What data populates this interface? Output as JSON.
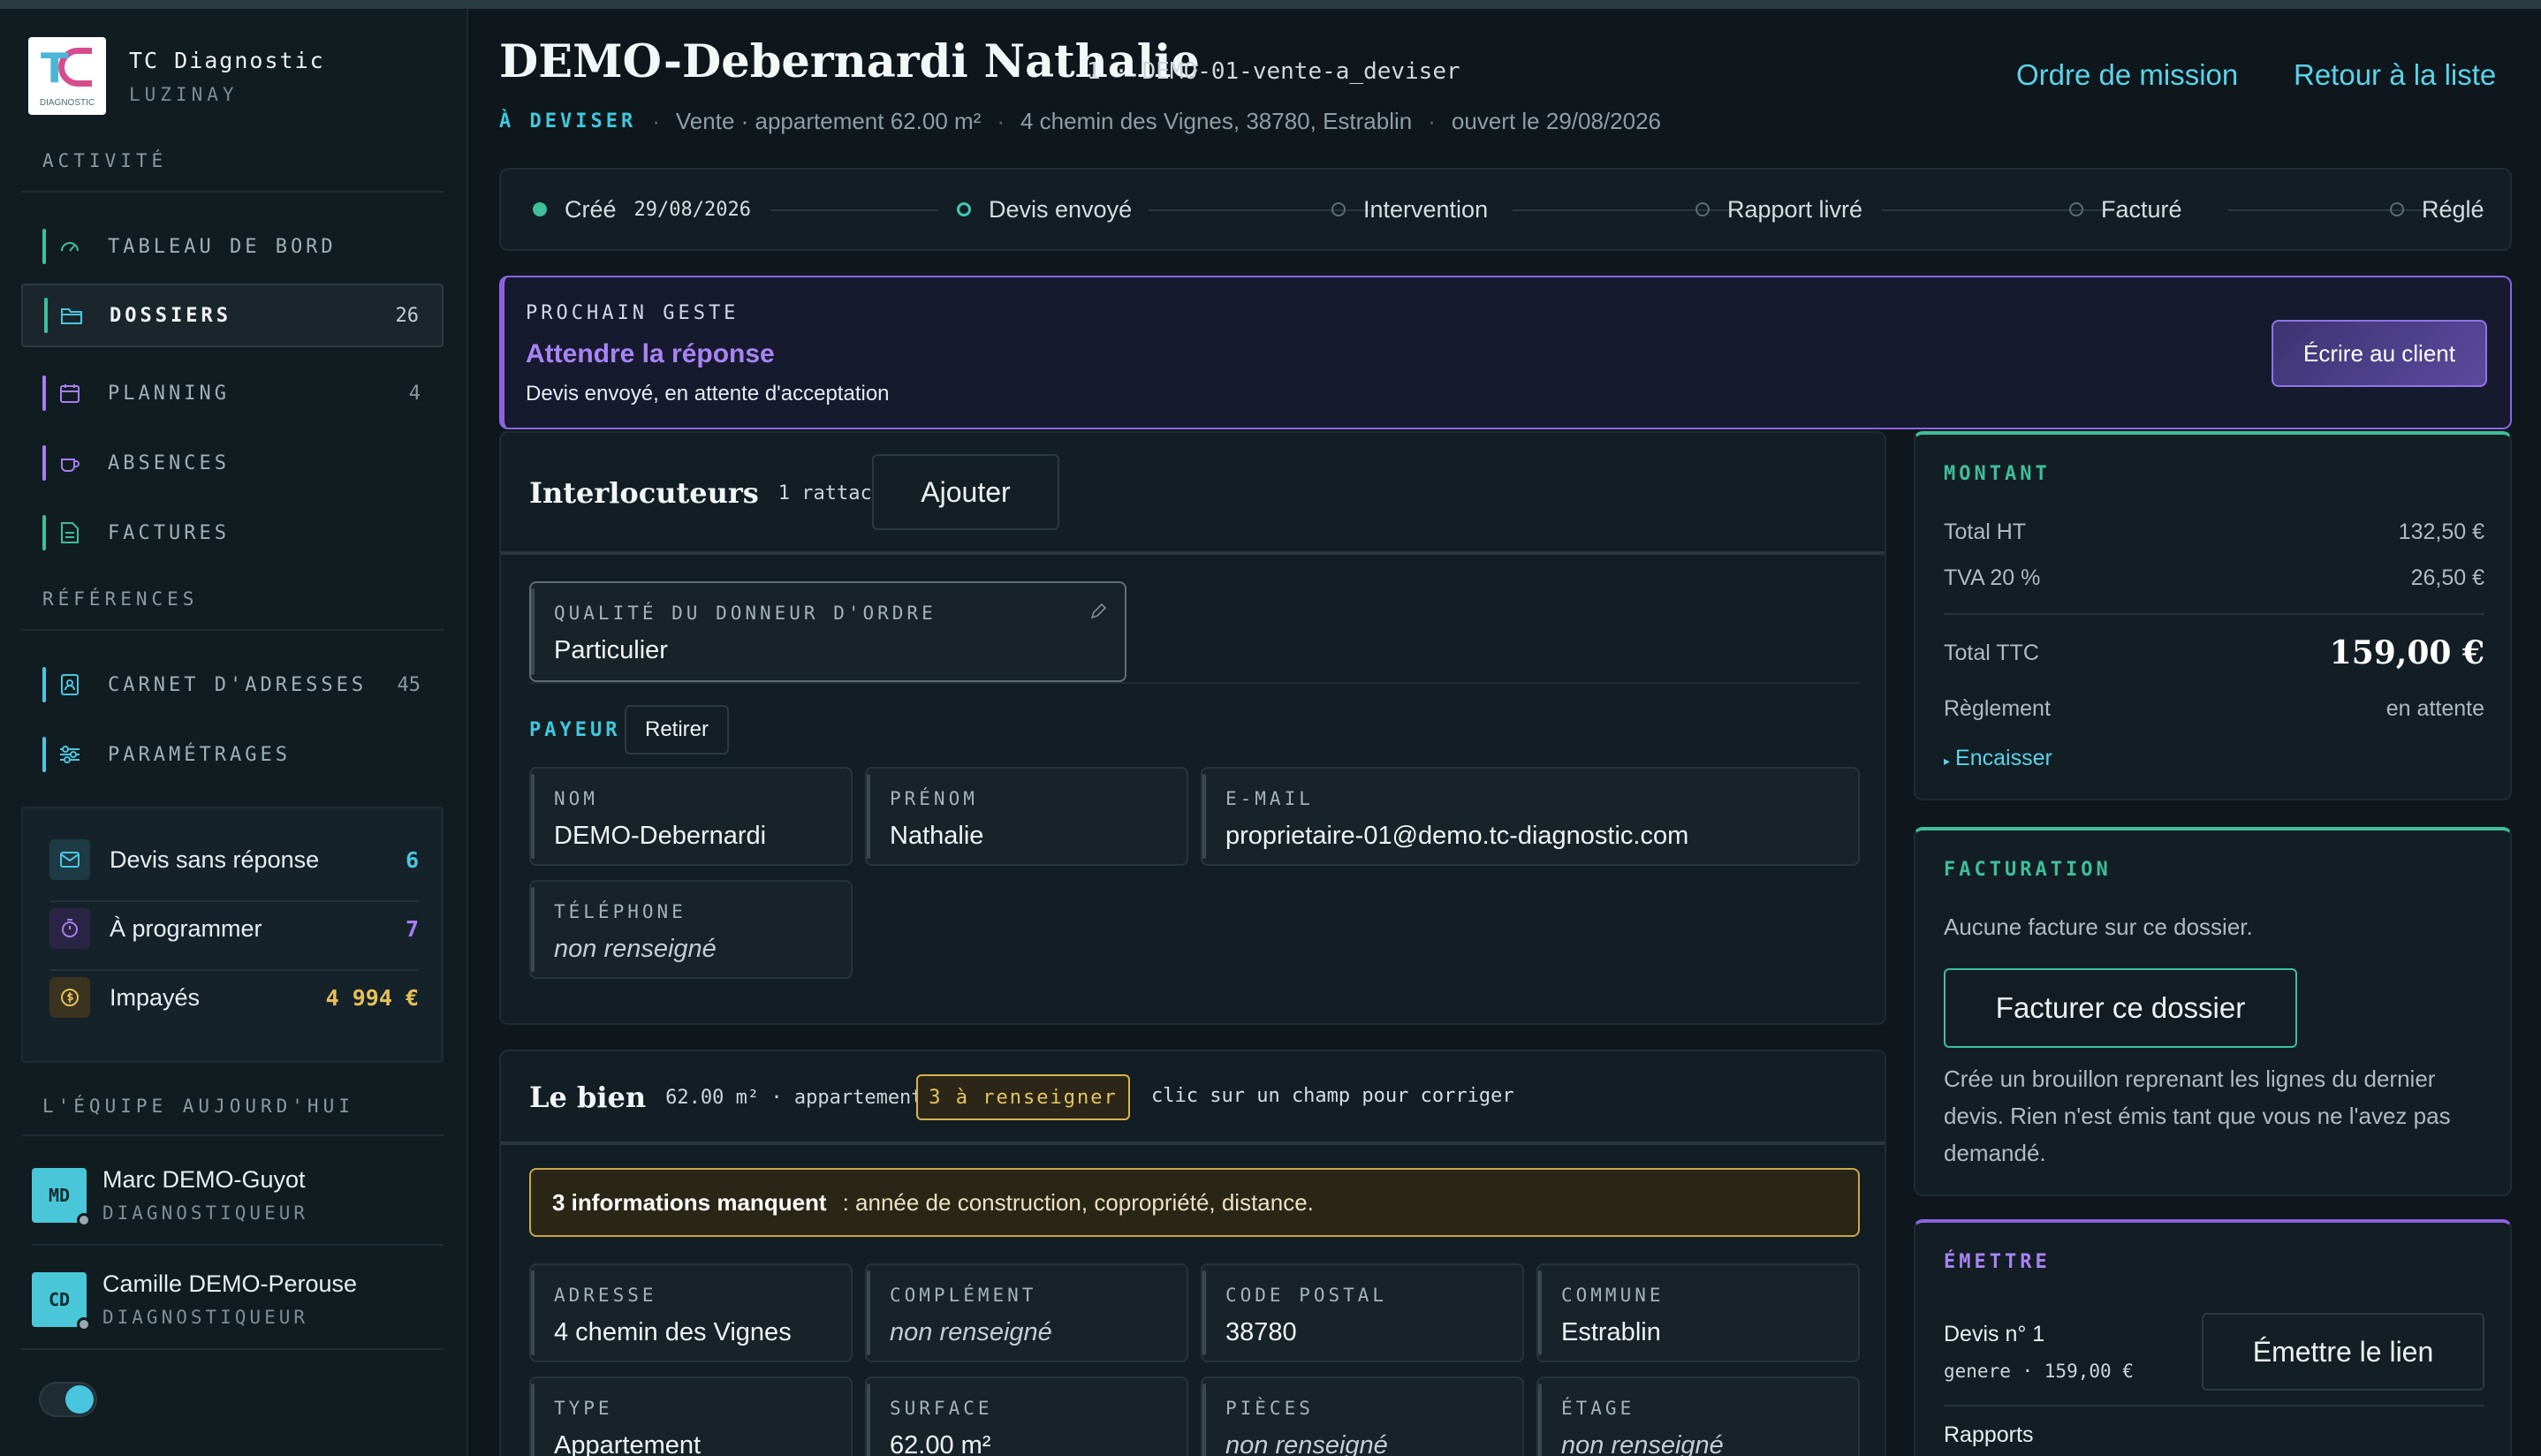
{
  "brand": {
    "name": "TC Diagnostic",
    "subtitle": "LUZINAY",
    "logo_text": "TC",
    "logo_sub": "DIAGNOSTIC"
  },
  "sidebar": {
    "activite_label": "ACTIVITÉ",
    "activite": [
      {
        "label": "TABLEAU DE BORD",
        "count": "",
        "icon": "gauge-icon"
      },
      {
        "label": "DOSSIERS",
        "count": "26",
        "icon": "folder-icon"
      },
      {
        "label": "PLANNING",
        "count": "4",
        "icon": "calendar-icon"
      },
      {
        "label": "ABSENCES",
        "count": "",
        "icon": "mug-icon"
      },
      {
        "label": "FACTURES",
        "count": "",
        "icon": "document-icon"
      }
    ],
    "references_label": "RÉFÉRENCES",
    "references": [
      {
        "label": "CARNET D'ADRESSES",
        "count": "45",
        "icon": "contact-book-icon"
      },
      {
        "label": "PARAMÉTRAGES",
        "count": "",
        "icon": "sliders-icon"
      }
    ],
    "stats": [
      {
        "label": "Devis sans réponse",
        "value": "6",
        "color": "#4bc6e0",
        "icon": "envelope-icon"
      },
      {
        "label": "À programmer",
        "value": "7",
        "color": "#a77ef2",
        "icon": "timer-icon"
      },
      {
        "label": "Impayés",
        "value": "4 994 €",
        "color": "#e4c05a",
        "icon": "coin-icon"
      }
    ],
    "team_label": "L'ÉQUIPE AUJOURD'HUI",
    "team": [
      {
        "initials": "MD",
        "name": "Marc DEMO-Guyot",
        "role": "DIAGNOSTIQUEUR"
      },
      {
        "initials": "CD",
        "name": "Camille DEMO-Perouse",
        "role": "DIAGNOSTIQUEUR"
      }
    ]
  },
  "header": {
    "title": "DEMO-Debernardi Nathalie",
    "meta": "1 · DEMO-01-vente-a_deviser",
    "link_mission": "Ordre de mission",
    "link_back": "Retour à la liste",
    "status": "À DEVISER",
    "sub1": "Vente · appartement 62.00 m²",
    "sub2": "4 chemin des Vignes, 38780, Estrablin",
    "sub3": "ouvert le 29/08/2026"
  },
  "progress": {
    "steps": [
      {
        "label": "Créé",
        "date": "29/08/2026",
        "state": "done"
      },
      {
        "label": "Devis envoyé",
        "date": "",
        "state": "current"
      },
      {
        "label": "Intervention",
        "date": "",
        "state": "todo"
      },
      {
        "label": "Rapport livré",
        "date": "",
        "state": "todo"
      },
      {
        "label": "Facturé",
        "date": "",
        "state": "todo"
      },
      {
        "label": "Réglé",
        "date": "",
        "state": "todo"
      }
    ],
    "colors": {
      "done": "#3fbf9a",
      "current": "#3fc8b4"
    }
  },
  "next_action": {
    "label": "PROCHAIN GESTE",
    "title": "Attendre la réponse",
    "description": "Devis envoyé, en attente d'acceptation",
    "button": "Écrire au client"
  },
  "interlocuteurs": {
    "title": "Interlocuteurs",
    "count": "1 rattaché",
    "add_button": "Ajouter",
    "qualite_label": "QUALITÉ DU DONNEUR D'ORDRE",
    "qualite_value": "Particulier",
    "payeur_label": "PAYEUR",
    "remove_button": "Retirer",
    "fields": {
      "nom_label": "NOM",
      "nom": "DEMO-Debernardi",
      "prenom_label": "PRÉNOM",
      "prenom": "Nathalie",
      "email_label": "E-MAIL",
      "email": "proprietaire-01@demo.tc-diagnostic.com",
      "tel_label": "TÉLÉPHONE",
      "tel": "non renseigné"
    }
  },
  "bien": {
    "title": "Le bien",
    "meta": "62.00 m² · appartement",
    "badge": "3 à renseigner",
    "hint": "clic sur un champ pour corriger",
    "missing_strong": "3 informations manquent",
    "missing_text": ": année de construction, copropriété, distance.",
    "fields": [
      {
        "label": "ADRESSE",
        "value": "4 chemin des Vignes",
        "empty": false
      },
      {
        "label": "COMPLÉMENT",
        "value": "non renseigné",
        "empty": true
      },
      {
        "label": "CODE POSTAL",
        "value": "38780",
        "empty": false
      },
      {
        "label": "COMMUNE",
        "value": "Estrablin",
        "empty": false
      },
      {
        "label": "TYPE",
        "value": "Appartement",
        "empty": false
      },
      {
        "label": "SURFACE",
        "value": "62.00 m²",
        "empty": false
      },
      {
        "label": "PIÈCES",
        "value": "non renseigné",
        "empty": true
      },
      {
        "label": "ÉTAGE",
        "value": "non renseigné",
        "empty": true
      }
    ]
  },
  "montant": {
    "title": "MONTANT",
    "ht_label": "Total HT",
    "ht": "132,50 €",
    "tva_label": "TVA 20 %",
    "tva": "26,50 €",
    "ttc_label": "Total TTC",
    "ttc": "159,00 €",
    "reglement_label": "Règlement",
    "reglement": "en attente",
    "encaisser": "Encaisser"
  },
  "facturation": {
    "title": "FACTURATION",
    "none": "Aucune facture sur ce dossier.",
    "button": "Facturer ce dossier",
    "note": "Crée un brouillon reprenant les lignes du dernier devis. Rien n'est émis tant que vous ne l'avez pas demandé."
  },
  "emettre": {
    "title": "ÉMETTRE",
    "devis_label": "Devis n° 1",
    "devis_meta": "genere · 159,00 €",
    "button": "Émettre le lien",
    "rapports": "Rapports"
  },
  "accents": {
    "teal": "#3fc8dc",
    "green": "#3fbf9a",
    "purple": "#8b63e0",
    "amber": "#d8b24a"
  }
}
